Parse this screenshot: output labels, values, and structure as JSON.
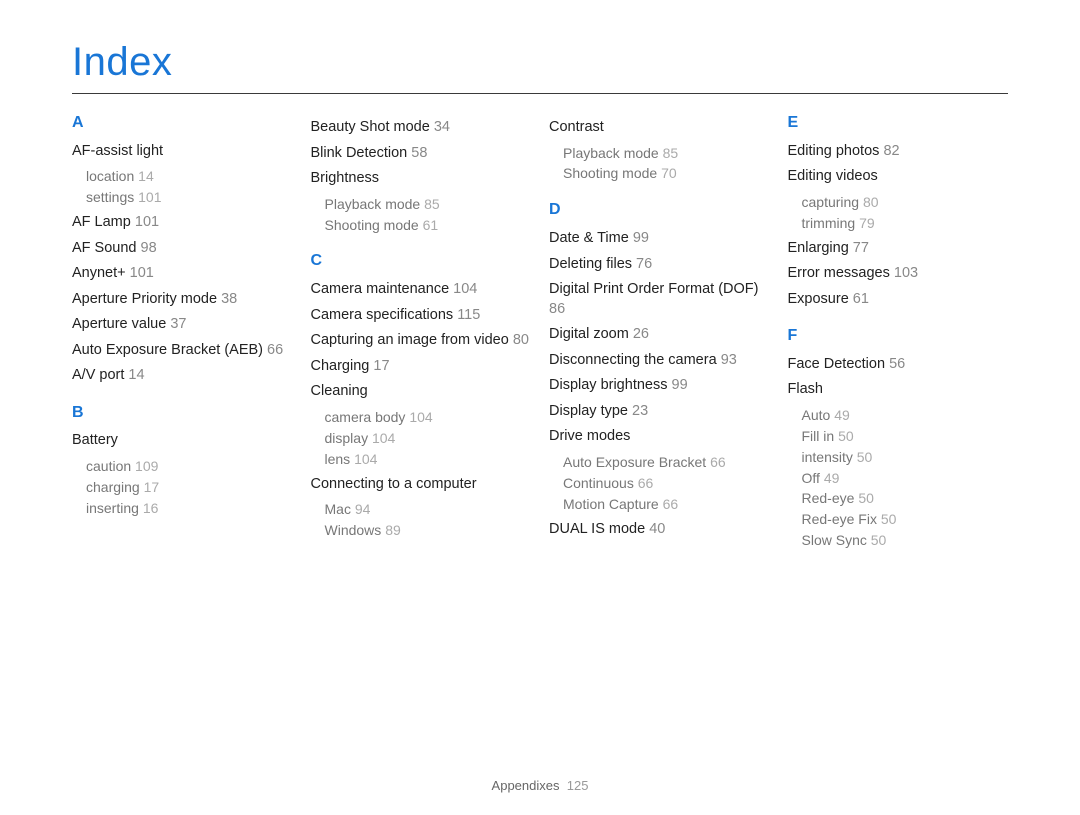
{
  "title": "Index",
  "footer": {
    "section": "Appendixes",
    "page": "125"
  },
  "columns": [
    {
      "blocks": [
        {
          "type": "letter",
          "text": "A"
        },
        {
          "type": "entry",
          "label": "AF-assist light",
          "sub": [
            {
              "label": "location",
              "pg": "14"
            },
            {
              "label": "settings",
              "pg": "101"
            }
          ]
        },
        {
          "type": "entry",
          "label": "AF Lamp",
          "pg": "101"
        },
        {
          "type": "entry",
          "label": "AF Sound",
          "pg": "98"
        },
        {
          "type": "entry",
          "label": "Anynet+",
          "pg": "101"
        },
        {
          "type": "entry",
          "label": "Aperture Priority mode",
          "pg": "38"
        },
        {
          "type": "entry",
          "label": "Aperture value",
          "pg": "37"
        },
        {
          "type": "entry",
          "label": "Auto Exposure Bracket (AEB)",
          "pg": "66"
        },
        {
          "type": "entry",
          "label": "A/V port",
          "pg": "14"
        },
        {
          "type": "letter",
          "text": "B"
        },
        {
          "type": "entry",
          "label": "Battery",
          "sub": [
            {
              "label": "caution",
              "pg": "109"
            },
            {
              "label": "charging",
              "pg": "17"
            },
            {
              "label": "inserting",
              "pg": "16"
            }
          ]
        }
      ]
    },
    {
      "blocks": [
        {
          "type": "entry",
          "label": "Beauty Shot mode",
          "pg": "34"
        },
        {
          "type": "entry",
          "label": "Blink Detection",
          "pg": "58"
        },
        {
          "type": "entry",
          "label": "Brightness",
          "sub": [
            {
              "label": "Playback mode",
              "pg": "85"
            },
            {
              "label": "Shooting mode",
              "pg": "61"
            }
          ]
        },
        {
          "type": "letter",
          "text": "C"
        },
        {
          "type": "entry",
          "label": "Camera maintenance",
          "pg": "104"
        },
        {
          "type": "entry",
          "label": "Camera specifications",
          "pg": "115"
        },
        {
          "type": "entry",
          "label": "Capturing an image from video",
          "pg": "80"
        },
        {
          "type": "entry",
          "label": "Charging",
          "pg": "17"
        },
        {
          "type": "entry",
          "label": "Cleaning",
          "sub": [
            {
              "label": "camera body",
              "pg": "104"
            },
            {
              "label": "display",
              "pg": "104"
            },
            {
              "label": "lens",
              "pg": "104"
            }
          ]
        },
        {
          "type": "entry",
          "label": "Connecting to a computer",
          "sub": [
            {
              "label": "Mac",
              "pg": "94"
            },
            {
              "label": "Windows",
              "pg": "89"
            }
          ]
        }
      ]
    },
    {
      "blocks": [
        {
          "type": "entry",
          "label": "Contrast",
          "sub": [
            {
              "label": "Playback mode",
              "pg": "85"
            },
            {
              "label": "Shooting mode",
              "pg": "70"
            }
          ]
        },
        {
          "type": "letter",
          "text": "D"
        },
        {
          "type": "entry",
          "label": "Date & Time",
          "pg": "99"
        },
        {
          "type": "entry",
          "label": "Deleting files",
          "pg": "76"
        },
        {
          "type": "entry",
          "label": "Digital Print Order Format (DOF)",
          "pg": "86"
        },
        {
          "type": "entry",
          "label": "Digital zoom",
          "pg": "26"
        },
        {
          "type": "entry",
          "label": "Disconnecting the camera",
          "pg": "93"
        },
        {
          "type": "entry",
          "label": "Display brightness",
          "pg": "99"
        },
        {
          "type": "entry",
          "label": "Display type",
          "pg": "23"
        },
        {
          "type": "entry",
          "label": "Drive modes",
          "sub": [
            {
              "label": "Auto Exposure Bracket",
              "pg": "66"
            },
            {
              "label": "Continuous",
              "pg": "66"
            },
            {
              "label": "Motion Capture",
              "pg": "66"
            }
          ]
        },
        {
          "type": "entry",
          "label": "DUAL IS mode",
          "pg": "40"
        }
      ]
    },
    {
      "blocks": [
        {
          "type": "letter",
          "text": "E"
        },
        {
          "type": "entry",
          "label": "Editing photos",
          "pg": "82"
        },
        {
          "type": "entry",
          "label": "Editing videos",
          "sub": [
            {
              "label": "capturing",
              "pg": "80"
            },
            {
              "label": "trimming",
              "pg": "79"
            }
          ]
        },
        {
          "type": "entry",
          "label": "Enlarging",
          "pg": "77"
        },
        {
          "type": "entry",
          "label": "Error messages",
          "pg": "103"
        },
        {
          "type": "entry",
          "label": "Exposure",
          "pg": "61"
        },
        {
          "type": "letter",
          "text": "F"
        },
        {
          "type": "entry",
          "label": "Face Detection",
          "pg": "56"
        },
        {
          "type": "entry",
          "label": "Flash",
          "sub": [
            {
              "label": "Auto",
              "pg": "49"
            },
            {
              "label": "Fill in",
              "pg": "50"
            },
            {
              "label": "intensity",
              "pg": "50"
            },
            {
              "label": "Off",
              "pg": "49"
            },
            {
              "label": "Red-eye",
              "pg": "50"
            },
            {
              "label": "Red-eye Fix",
              "pg": "50"
            },
            {
              "label": "Slow Sync",
              "pg": "50"
            }
          ]
        }
      ]
    }
  ]
}
